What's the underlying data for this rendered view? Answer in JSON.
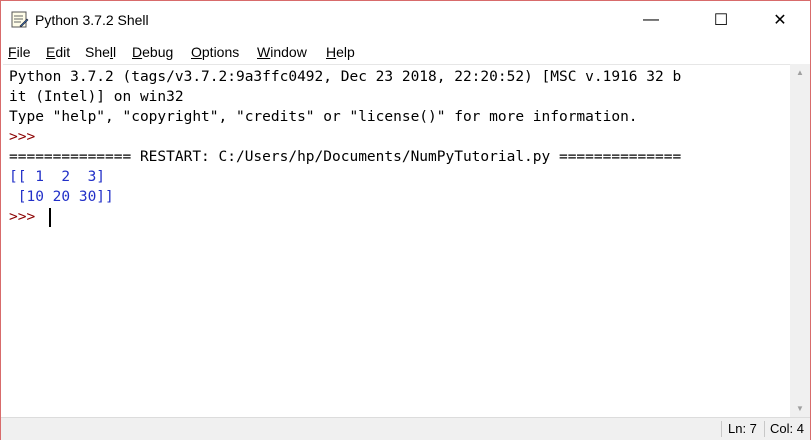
{
  "window": {
    "title": "Python 3.7.2 Shell",
    "controls": {
      "minimize": "—",
      "maximize": "☐",
      "close": "✕"
    }
  },
  "menu": [
    {
      "pre": "",
      "u": "F",
      "post": "ile"
    },
    {
      "pre": "",
      "u": "E",
      "post": "dit"
    },
    {
      "pre": "She",
      "u": "l",
      "post": "l"
    },
    {
      "pre": "",
      "u": "D",
      "post": "ebug"
    },
    {
      "pre": "",
      "u": "O",
      "post": "ptions"
    },
    {
      "pre": "",
      "u": "W",
      "post": "indow"
    },
    {
      "pre": "",
      "u": "H",
      "post": "elp"
    }
  ],
  "shell": {
    "banner_line1": "Python 3.7.2 (tags/v3.7.2:9a3ffc0492, Dec 23 2018, 22:20:52) [MSC v.1916 32 b",
    "banner_line2": "it (Intel)] on win32",
    "help_line": "Type \"help\", \"copyright\", \"credits\" or \"license()\" for more information.",
    "prompt1": ">>> ",
    "restart_line": "============== RESTART: C:/Users/hp/Documents/NumPyTutorial.py ==============",
    "output1": "[[ 1  2  3]",
    "output2": " [10 20 30]]",
    "prompt2": ">>> "
  },
  "status": {
    "line": "Ln: 7",
    "col": "Col: 4"
  },
  "colors": {
    "prompt": "#8b0000",
    "output": "#2230c8",
    "text": "#000000"
  }
}
